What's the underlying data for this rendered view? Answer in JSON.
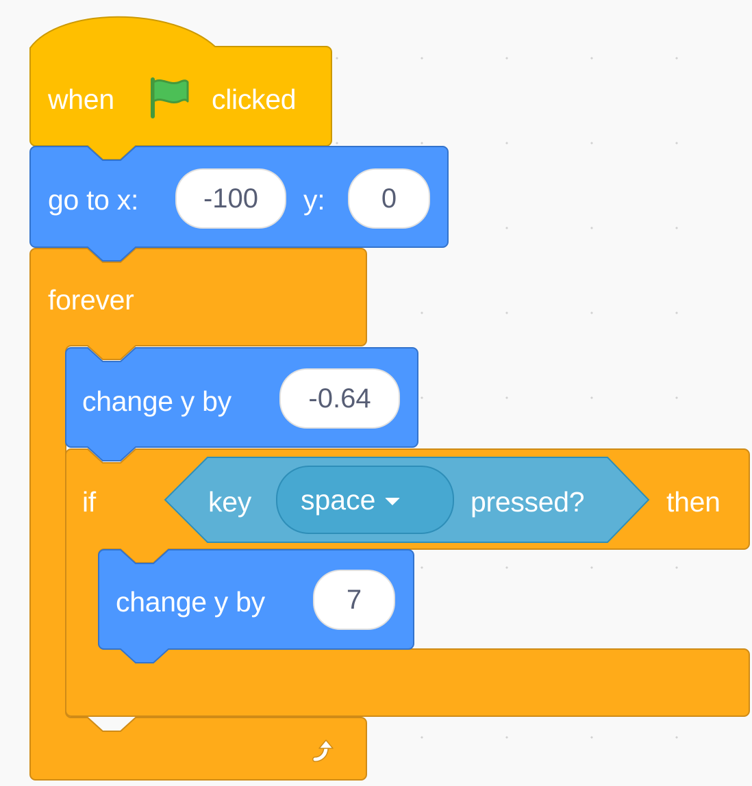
{
  "colors": {
    "events": "#ffbf00",
    "events_border": "#cc9900",
    "motion": "#4c97ff",
    "motion_border": "#3373cc",
    "control": "#ffab19",
    "control_border": "#cf8b17",
    "sensing": "#5cb1d6",
    "sensing_border": "#2e8eb8",
    "flag": "#4cbf56"
  },
  "script": {
    "hat": {
      "when": "when",
      "flag_icon": "green-flag-icon",
      "clicked": "clicked"
    },
    "goto": {
      "label": "go to x:",
      "x": "-100",
      "y_label": "y:",
      "y": "0"
    },
    "forever": {
      "label": "forever",
      "loop_icon": "rotate-arrow-icon"
    },
    "change_y_1": {
      "label": "change y by",
      "value": "-0.64"
    },
    "if_block": {
      "if_label": "if",
      "then_label": "then",
      "condition": {
        "key_label": "key",
        "key_value": "space",
        "pressed_label": "pressed?"
      }
    },
    "change_y_2": {
      "label": "change y by",
      "value": "7"
    }
  }
}
